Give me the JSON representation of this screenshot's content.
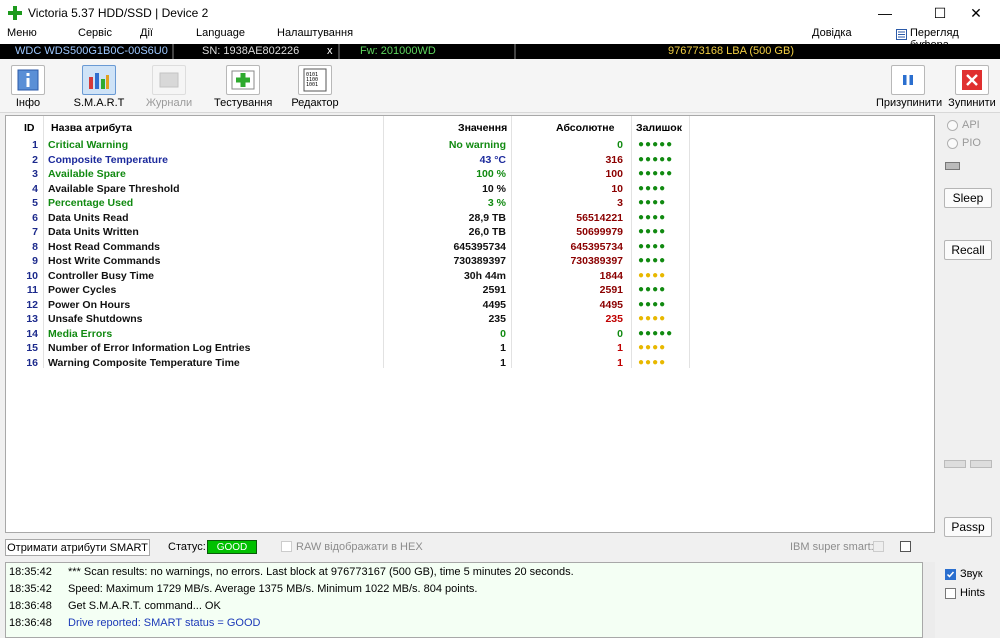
{
  "window": {
    "title": "Victoria 5.37 HDD/SSD | Device 2",
    "minimize": "—",
    "maximize": "☐",
    "close": "✕"
  },
  "menu": {
    "items": [
      "Меню",
      "Сервіс",
      "Дії",
      "Language",
      "Налаштування"
    ],
    "help": "Довідка",
    "buffer": "Перегляд буфера"
  },
  "device": {
    "model": "WDC WDS500G1B0C-00S6U0",
    "serial": "SN: 1938AE802226",
    "close_x": "x",
    "firmware": "Fw: 201000WD",
    "lba": "976773168 LBA (500 GB)"
  },
  "toolbar": {
    "info": "Інфо",
    "smart": "S.M.A.R.T",
    "journals": "Журнали",
    "testing": "Тестування",
    "editor": "Редактор",
    "pause": "Призупинити",
    "stop": "Зупинити"
  },
  "table": {
    "headers": {
      "id": "ID",
      "name": "Назва атрибута",
      "value": "Значення",
      "absolute": "Абсолютне",
      "remaining": "Залишок"
    },
    "rows": [
      {
        "id": "1",
        "name": "Critical Warning",
        "value": "No warning",
        "abs": "0",
        "rem": "●●●●●",
        "name_color": "#118a11",
        "val_color": "#118a11",
        "abs_color": "#118a11",
        "rem_color": "#118a11"
      },
      {
        "id": "2",
        "name": "Composite Temperature",
        "value": "43 °C",
        "abs": "316",
        "rem": "●●●●●",
        "name_color": "#1c2a9c",
        "val_color": "#1c2a9c",
        "abs_color": "#8b0000",
        "rem_color": "#118a11"
      },
      {
        "id": "3",
        "name": "Available Spare",
        "value": "100 %",
        "abs": "100",
        "rem": "●●●●●",
        "name_color": "#118a11",
        "val_color": "#118a11",
        "abs_color": "#8b0000",
        "rem_color": "#118a11"
      },
      {
        "id": "4",
        "name": "Available Spare Threshold",
        "value": "10 %",
        "abs": "10",
        "rem": "●●●●",
        "name_color": "#111111",
        "val_color": "#111111",
        "abs_color": "#8b0000",
        "rem_color": "#118a11"
      },
      {
        "id": "5",
        "name": "Percentage Used",
        "value": "3 %",
        "abs": "3",
        "rem": "●●●●",
        "name_color": "#118a11",
        "val_color": "#118a11",
        "abs_color": "#8b0000",
        "rem_color": "#118a11"
      },
      {
        "id": "6",
        "name": "Data Units Read",
        "value": "28,9 TB",
        "abs": "56514221",
        "rem": "●●●●",
        "name_color": "#111111",
        "val_color": "#111111",
        "abs_color": "#8b0000",
        "rem_color": "#118a11"
      },
      {
        "id": "7",
        "name": "Data Units Written",
        "value": "26,0 TB",
        "abs": "50699979",
        "rem": "●●●●",
        "name_color": "#111111",
        "val_color": "#111111",
        "abs_color": "#8b0000",
        "rem_color": "#118a11"
      },
      {
        "id": "8",
        "name": "Host Read Commands",
        "value": "645395734",
        "abs": "645395734",
        "rem": "●●●●",
        "name_color": "#111111",
        "val_color": "#111111",
        "abs_color": "#8b0000",
        "rem_color": "#118a11"
      },
      {
        "id": "9",
        "name": "Host Write Commands",
        "value": "730389397",
        "abs": "730389397",
        "rem": "●●●●",
        "name_color": "#111111",
        "val_color": "#111111",
        "abs_color": "#8b0000",
        "rem_color": "#118a11"
      },
      {
        "id": "10",
        "name": "Controller Busy Time",
        "value": "30h 44m",
        "abs": "1844",
        "rem": "●●●●",
        "name_color": "#111111",
        "val_color": "#111111",
        "abs_color": "#8b0000",
        "rem_color": "#e8b800"
      },
      {
        "id": "11",
        "name": "Power Cycles",
        "value": "2591",
        "abs": "2591",
        "rem": "●●●●",
        "name_color": "#111111",
        "val_color": "#111111",
        "abs_color": "#8b0000",
        "rem_color": "#118a11"
      },
      {
        "id": "12",
        "name": "Power On Hours",
        "value": "4495",
        "abs": "4495",
        "rem": "●●●●",
        "name_color": "#111111",
        "val_color": "#111111",
        "abs_color": "#8b0000",
        "rem_color": "#118a11"
      },
      {
        "id": "13",
        "name": "Unsafe Shutdowns",
        "value": "235",
        "abs": "235",
        "rem": "●●●●",
        "name_color": "#111111",
        "val_color": "#111111",
        "abs_color": "#c00000",
        "rem_color": "#e8b800"
      },
      {
        "id": "14",
        "name": "Media Errors",
        "value": "0",
        "abs": "0",
        "rem": "●●●●●",
        "name_color": "#118a11",
        "val_color": "#118a11",
        "abs_color": "#118a11",
        "rem_color": "#118a11"
      },
      {
        "id": "15",
        "name": "Number of Error Information Log Entries",
        "value": "1",
        "abs": "1",
        "rem": "●●●●",
        "name_color": "#111111",
        "val_color": "#111111",
        "abs_color": "#c00000",
        "rem_color": "#e8b800"
      },
      {
        "id": "16",
        "name": "Warning Composite Temperature Time",
        "value": "1",
        "abs": "1",
        "rem": "●●●●",
        "name_color": "#111111",
        "val_color": "#111111",
        "abs_color": "#c00000",
        "rem_color": "#e8b800"
      }
    ]
  },
  "right_panel": {
    "api": "API",
    "pio": "PIO",
    "sleep": "Sleep",
    "recall": "Recall",
    "passp": "Passp"
  },
  "status_bar": {
    "get_smart": "Отримати атрибути SMART",
    "status_label": "Статус:",
    "status_value": "GOOD",
    "raw_hex": "RAW відображати в HEX",
    "ibm": "IBM super smart:"
  },
  "log": [
    {
      "time": "18:35:42",
      "msg": "*** Scan results: no warnings, no errors. Last block at 976773167 (500 GB), time 5 minutes 20 seconds.",
      "color": "#000000"
    },
    {
      "time": "18:35:42",
      "msg": "Speed: Maximum 1729 MB/s. Average 1375 MB/s. Minimum 1022 MB/s. 804 points.",
      "color": "#000000"
    },
    {
      "time": "18:36:48",
      "msg": "Get S.M.A.R.T. command... OK",
      "color": "#000000"
    },
    {
      "time": "18:36:48",
      "msg": "Drive reported: SMART status = GOOD",
      "color": "#1c3ab8"
    }
  ],
  "log_panel": {
    "sound": "Звук",
    "hints": "Hints"
  }
}
